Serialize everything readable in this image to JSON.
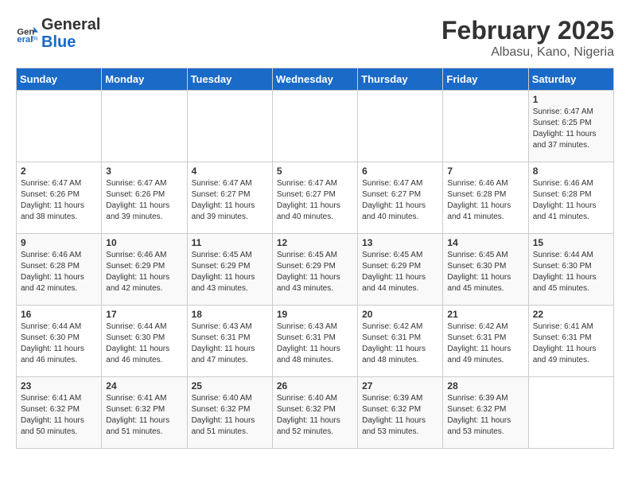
{
  "logo": {
    "general": "General",
    "blue": "Blue"
  },
  "header": {
    "month": "February 2025",
    "location": "Albasu, Kano, Nigeria"
  },
  "weekdays": [
    "Sunday",
    "Monday",
    "Tuesday",
    "Wednesday",
    "Thursday",
    "Friday",
    "Saturday"
  ],
  "weeks": [
    [
      {
        "day": "",
        "info": ""
      },
      {
        "day": "",
        "info": ""
      },
      {
        "day": "",
        "info": ""
      },
      {
        "day": "",
        "info": ""
      },
      {
        "day": "",
        "info": ""
      },
      {
        "day": "",
        "info": ""
      },
      {
        "day": "1",
        "info": "Sunrise: 6:47 AM\nSunset: 6:25 PM\nDaylight: 11 hours and 37 minutes."
      }
    ],
    [
      {
        "day": "2",
        "info": "Sunrise: 6:47 AM\nSunset: 6:26 PM\nDaylight: 11 hours and 38 minutes."
      },
      {
        "day": "3",
        "info": "Sunrise: 6:47 AM\nSunset: 6:26 PM\nDaylight: 11 hours and 39 minutes."
      },
      {
        "day": "4",
        "info": "Sunrise: 6:47 AM\nSunset: 6:27 PM\nDaylight: 11 hours and 39 minutes."
      },
      {
        "day": "5",
        "info": "Sunrise: 6:47 AM\nSunset: 6:27 PM\nDaylight: 11 hours and 40 minutes."
      },
      {
        "day": "6",
        "info": "Sunrise: 6:47 AM\nSunset: 6:27 PM\nDaylight: 11 hours and 40 minutes."
      },
      {
        "day": "7",
        "info": "Sunrise: 6:46 AM\nSunset: 6:28 PM\nDaylight: 11 hours and 41 minutes."
      },
      {
        "day": "8",
        "info": "Sunrise: 6:46 AM\nSunset: 6:28 PM\nDaylight: 11 hours and 41 minutes."
      }
    ],
    [
      {
        "day": "9",
        "info": "Sunrise: 6:46 AM\nSunset: 6:28 PM\nDaylight: 11 hours and 42 minutes."
      },
      {
        "day": "10",
        "info": "Sunrise: 6:46 AM\nSunset: 6:29 PM\nDaylight: 11 hours and 42 minutes."
      },
      {
        "day": "11",
        "info": "Sunrise: 6:45 AM\nSunset: 6:29 PM\nDaylight: 11 hours and 43 minutes."
      },
      {
        "day": "12",
        "info": "Sunrise: 6:45 AM\nSunset: 6:29 PM\nDaylight: 11 hours and 43 minutes."
      },
      {
        "day": "13",
        "info": "Sunrise: 6:45 AM\nSunset: 6:29 PM\nDaylight: 11 hours and 44 minutes."
      },
      {
        "day": "14",
        "info": "Sunrise: 6:45 AM\nSunset: 6:30 PM\nDaylight: 11 hours and 45 minutes."
      },
      {
        "day": "15",
        "info": "Sunrise: 6:44 AM\nSunset: 6:30 PM\nDaylight: 11 hours and 45 minutes."
      }
    ],
    [
      {
        "day": "16",
        "info": "Sunrise: 6:44 AM\nSunset: 6:30 PM\nDaylight: 11 hours and 46 minutes."
      },
      {
        "day": "17",
        "info": "Sunrise: 6:44 AM\nSunset: 6:30 PM\nDaylight: 11 hours and 46 minutes."
      },
      {
        "day": "18",
        "info": "Sunrise: 6:43 AM\nSunset: 6:31 PM\nDaylight: 11 hours and 47 minutes."
      },
      {
        "day": "19",
        "info": "Sunrise: 6:43 AM\nSunset: 6:31 PM\nDaylight: 11 hours and 48 minutes."
      },
      {
        "day": "20",
        "info": "Sunrise: 6:42 AM\nSunset: 6:31 PM\nDaylight: 11 hours and 48 minutes."
      },
      {
        "day": "21",
        "info": "Sunrise: 6:42 AM\nSunset: 6:31 PM\nDaylight: 11 hours and 49 minutes."
      },
      {
        "day": "22",
        "info": "Sunrise: 6:41 AM\nSunset: 6:31 PM\nDaylight: 11 hours and 49 minutes."
      }
    ],
    [
      {
        "day": "23",
        "info": "Sunrise: 6:41 AM\nSunset: 6:32 PM\nDaylight: 11 hours and 50 minutes."
      },
      {
        "day": "24",
        "info": "Sunrise: 6:41 AM\nSunset: 6:32 PM\nDaylight: 11 hours and 51 minutes."
      },
      {
        "day": "25",
        "info": "Sunrise: 6:40 AM\nSunset: 6:32 PM\nDaylight: 11 hours and 51 minutes."
      },
      {
        "day": "26",
        "info": "Sunrise: 6:40 AM\nSunset: 6:32 PM\nDaylight: 11 hours and 52 minutes."
      },
      {
        "day": "27",
        "info": "Sunrise: 6:39 AM\nSunset: 6:32 PM\nDaylight: 11 hours and 53 minutes."
      },
      {
        "day": "28",
        "info": "Sunrise: 6:39 AM\nSunset: 6:32 PM\nDaylight: 11 hours and 53 minutes."
      },
      {
        "day": "",
        "info": ""
      }
    ]
  ]
}
